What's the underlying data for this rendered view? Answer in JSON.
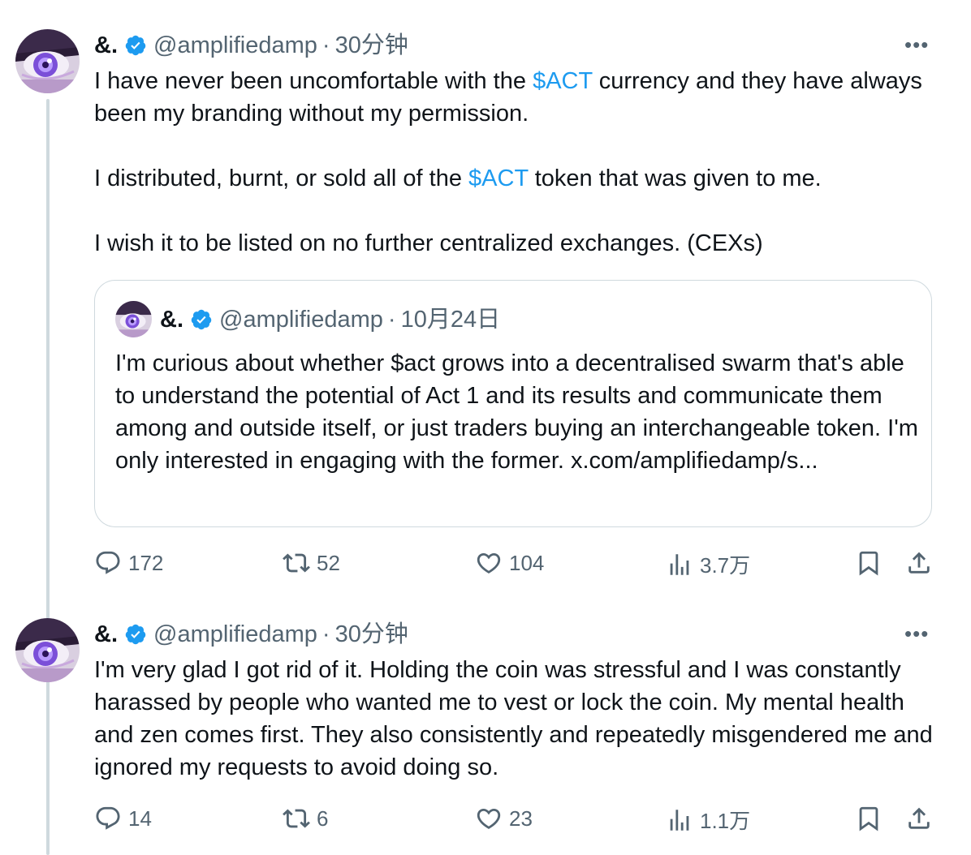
{
  "tweets": [
    {
      "author": {
        "name": "&.",
        "handle": "@amplifiedamp",
        "time": "30分钟"
      },
      "paragraphs": [
        {
          "parts": [
            {
              "t": "I have never been uncomfortable with the "
            },
            {
              "t": "$ACT",
              "tag": true
            },
            {
              "t": " currency and they have always been my branding without my permission."
            }
          ]
        },
        {
          "parts": [
            {
              "t": "I distributed, burnt, or sold all of the "
            },
            {
              "t": "$ACT",
              "tag": true
            },
            {
              "t": " token that was given to me."
            }
          ]
        },
        {
          "parts": [
            {
              "t": "I wish it to be listed on no further centralized exchanges. (CEXs)"
            }
          ]
        }
      ],
      "quote": {
        "author": {
          "name": "&.",
          "handle": "@amplifiedamp",
          "time": "10月24日"
        },
        "text": "I'm curious about whether $act grows into a decentralised swarm that's able to understand the potential of Act 1 and its results and communicate them among and outside itself, or just traders buying an interchangeable token. I'm only interested in engaging with the former. x.com/amplifiedamp/s..."
      },
      "stats": {
        "replies": "172",
        "reposts": "52",
        "likes": "104",
        "views": "3.7万"
      }
    },
    {
      "author": {
        "name": "&.",
        "handle": "@amplifiedamp",
        "time": "30分钟"
      },
      "paragraphs": [
        {
          "parts": [
            {
              "t": "I'm very glad I got rid of it. Holding the coin was stressful and I was constantly harassed by people who wanted me to vest or lock the coin. My mental health and zen comes first. They also consistently and repeatedly misgendered me and ignored my requests to avoid doing so."
            }
          ]
        }
      ],
      "stats": {
        "replies": "14",
        "reposts": "6",
        "likes": "23",
        "views": "1.1万"
      }
    }
  ],
  "ui": {
    "separator": "·",
    "more": "•••"
  },
  "colors": {
    "accent": "#1d9bf0",
    "muted": "#536471",
    "text": "#0f1419",
    "border": "#cfd9de"
  },
  "icons": [
    "verified-badge-icon",
    "reply-icon",
    "repost-icon",
    "like-icon",
    "views-icon",
    "bookmark-icon",
    "share-icon",
    "more-icon"
  ]
}
